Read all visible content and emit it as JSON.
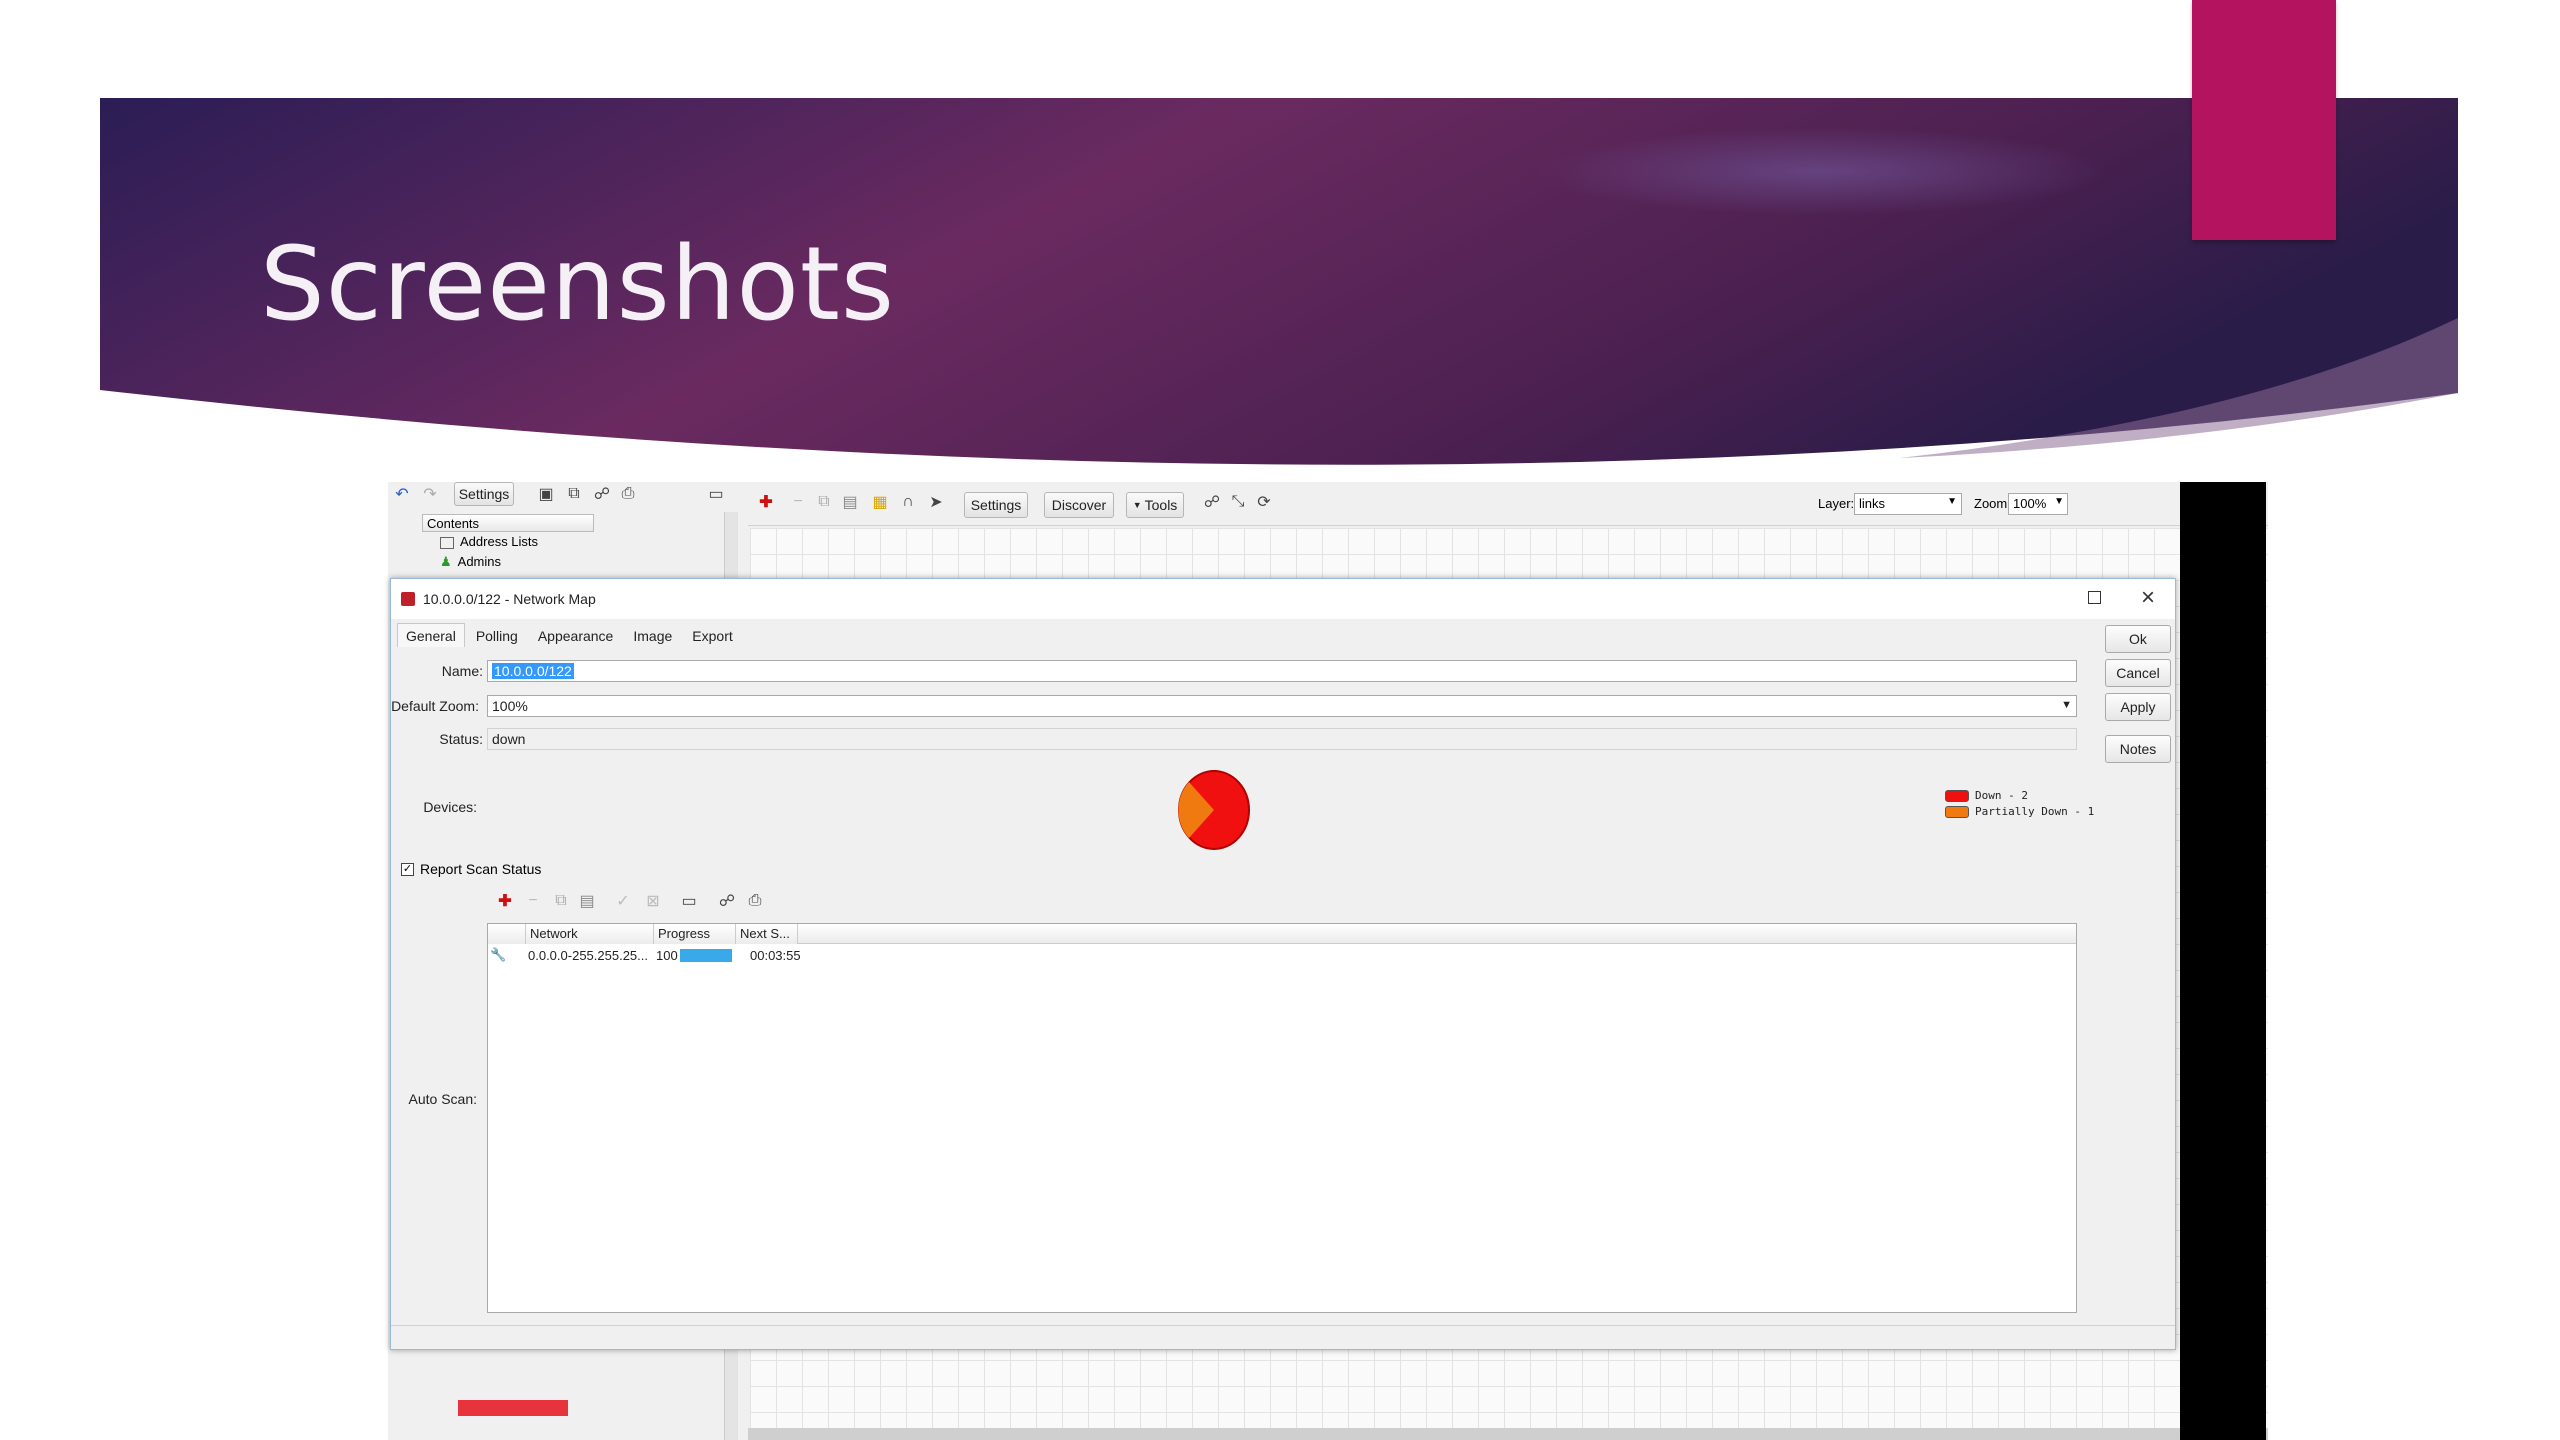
{
  "slide": {
    "title": "Screenshots"
  },
  "colors": {
    "banner_start": "#2e1e55",
    "banner_mid": "#6b2a5e",
    "accent": "#b3135f"
  },
  "left_pane": {
    "settings_label": "Settings",
    "contents_header": "Contents",
    "tree": [
      "Address Lists",
      "Admins"
    ]
  },
  "map_toolbar": {
    "settings_label": "Settings",
    "discover_label": "Discover",
    "tools_label": "Tools",
    "layer_label": "Layer:",
    "layer_value": "links",
    "zoom_label": "Zoom:",
    "zoom_value": "100%"
  },
  "dialog": {
    "title": "10.0.0.0/122 - Network Map",
    "tabs": [
      "General",
      "Polling",
      "Appearance",
      "Image",
      "Export"
    ],
    "name_label": "Name:",
    "name_value": "10.0.0.0/122",
    "zoom_label": "Default Zoom:",
    "zoom_value": "100%",
    "status_label": "Status:",
    "status_value": "down",
    "devices_label": "Devices:",
    "legend": [
      {
        "label": "Down - 2",
        "color": "#f01010"
      },
      {
        "label": "Partially Down - 1",
        "color": "#f07a10"
      }
    ],
    "report_scan_label": "Report Scan Status",
    "auto_scan_label": "Auto Scan:",
    "buttons": {
      "ok": "Ok",
      "cancel": "Cancel",
      "apply": "Apply",
      "notes": "Notes"
    },
    "scan_table": {
      "columns": [
        "Network",
        "Progress",
        "Next S..."
      ],
      "rows": [
        {
          "network": "0.0.0.0-255.255.25...",
          "progress": "100",
          "progress_fraction": 1.0,
          "next": "00:03:55"
        }
      ]
    }
  }
}
